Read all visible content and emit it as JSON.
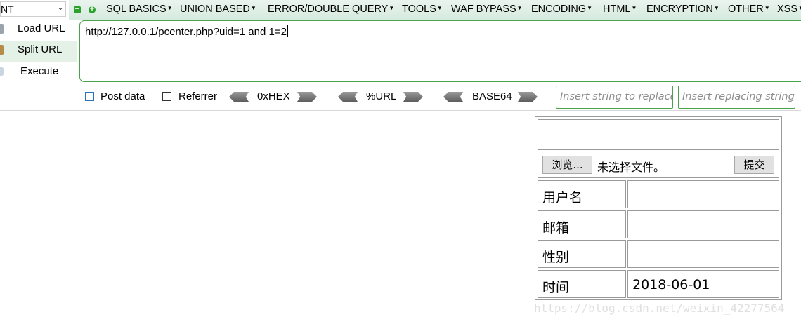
{
  "toolbar": {
    "dropdown_value": "NT",
    "menus": [
      {
        "label": "SQL BASICS",
        "key": "sql-basics"
      },
      {
        "label": "UNION BASED",
        "key": "union-based"
      },
      {
        "label": "ERROR/DOUBLE QUERY",
        "key": "error-double-query"
      },
      {
        "label": "TOOLS",
        "key": "tools"
      },
      {
        "label": "WAF BYPASS",
        "key": "waf-bypass"
      },
      {
        "label": "ENCODING",
        "key": "encoding"
      },
      {
        "label": "HTML",
        "key": "html"
      },
      {
        "label": "ENCRYPTION",
        "key": "encryption"
      },
      {
        "label": "OTHER",
        "key": "other"
      },
      {
        "label": "XSS",
        "key": "xss"
      }
    ]
  },
  "sidebar": {
    "load_url": "Load URL",
    "split_url": "Split URL",
    "execute": "Execute"
  },
  "url_field": {
    "value": "http://127.0.0.1/pcenter.php?uid=1 and 1=2"
  },
  "options": {
    "post_data": "Post data",
    "referrer": "Referrer",
    "hex": "0xHEX",
    "url_enc": "%URL",
    "base64": "BASE64",
    "replace_placeholder": "Insert string to replace",
    "replacing_placeholder": "Insert replacing string"
  },
  "form": {
    "browse_button": "浏览...",
    "file_status": "未选择文件。",
    "submit_button": "提交",
    "rows": [
      {
        "label": "用户名",
        "value": ""
      },
      {
        "label": "邮箱",
        "value": ""
      },
      {
        "label": "性别",
        "value": ""
      },
      {
        "label": "时间",
        "value": "2018-06-01"
      }
    ]
  },
  "watermark": "https://blog.csdn.net/weixin_42277564",
  "colors": {
    "accent_green": "#4aa24a",
    "menu_bg": "#d6eadf"
  }
}
